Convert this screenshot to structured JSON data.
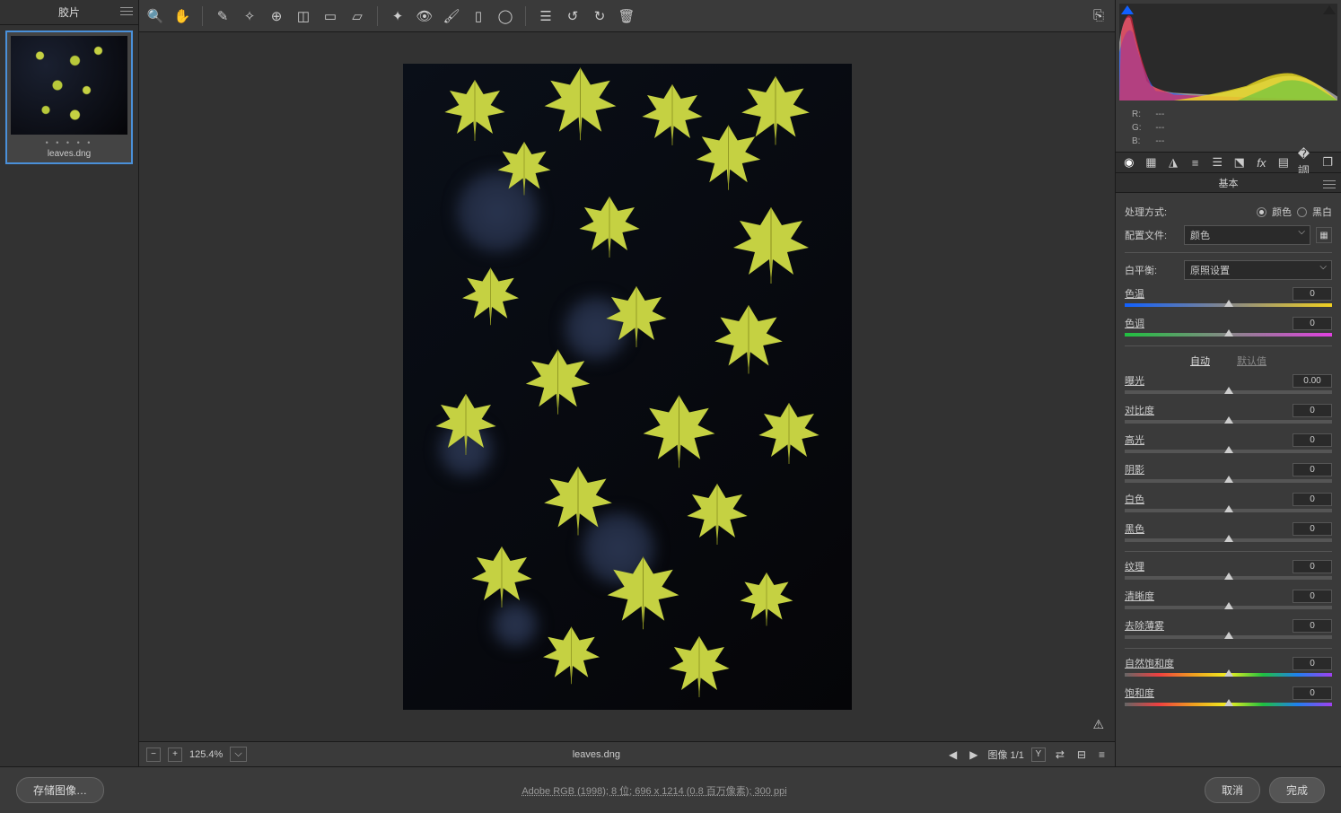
{
  "filmstrip": {
    "title": "胶片",
    "thumb_name": "leaves.dng"
  },
  "toolbar_icons": [
    "zoom",
    "hand",
    "eyedrop",
    "eyedrop2",
    "target",
    "crop",
    "straighten",
    "transform",
    "sep",
    "heal",
    "heal2",
    "redeye",
    "brush",
    "grad",
    "radial",
    "sep",
    "before",
    "rotate-l",
    "rotate-r",
    "delete"
  ],
  "canvas": {
    "filename": "leaves.dng",
    "warn": "⚠"
  },
  "zoombar": {
    "zoom": "125.4%",
    "image_counter": "图像 1/1",
    "toggle": "Y"
  },
  "histogram": {
    "rgb": {
      "r_label": "R:",
      "g_label": "G:",
      "b_label": "B:",
      "r": "---",
      "g": "---",
      "b": "---"
    }
  },
  "panel": {
    "title": "基本",
    "treatment_label": "处理方式:",
    "treatment_color": "颜色",
    "treatment_bw": "黑白",
    "profile_label": "配置文件:",
    "profile_value": "颜色",
    "wb_label": "白平衡:",
    "wb_value": "原照设置",
    "auto": "自动",
    "default": "默认值",
    "sliders": {
      "temp": {
        "label": "色温",
        "value": "0",
        "pos": 50,
        "grad": "temp"
      },
      "tint": {
        "label": "色调",
        "value": "0",
        "pos": 50,
        "grad": "tint"
      },
      "exposure": {
        "label": "曝光",
        "value": "0.00",
        "pos": 50
      },
      "contrast": {
        "label": "对比度",
        "value": "0",
        "pos": 50
      },
      "highlights": {
        "label": "高光",
        "value": "0",
        "pos": 50
      },
      "shadows": {
        "label": "阴影",
        "value": "0",
        "pos": 50
      },
      "whites": {
        "label": "白色",
        "value": "0",
        "pos": 50
      },
      "blacks": {
        "label": "黑色",
        "value": "0",
        "pos": 50
      },
      "texture": {
        "label": "纹理",
        "value": "0",
        "pos": 50
      },
      "clarity": {
        "label": "清晰度",
        "value": "0",
        "pos": 50
      },
      "dehaze": {
        "label": "去除薄雾",
        "value": "0",
        "pos": 50
      },
      "vibrance": {
        "label": "自然饱和度",
        "value": "0",
        "pos": 50,
        "grad": "vib"
      },
      "saturation": {
        "label": "饱和度",
        "value": "0",
        "pos": 50,
        "grad": "vib"
      }
    }
  },
  "footer": {
    "save": "存储图像…",
    "meta": "Adobe RGB (1998); 8 位; 696 x 1214 (0.8 百万像素); 300 ppi",
    "cancel": "取消",
    "done": "完成"
  }
}
